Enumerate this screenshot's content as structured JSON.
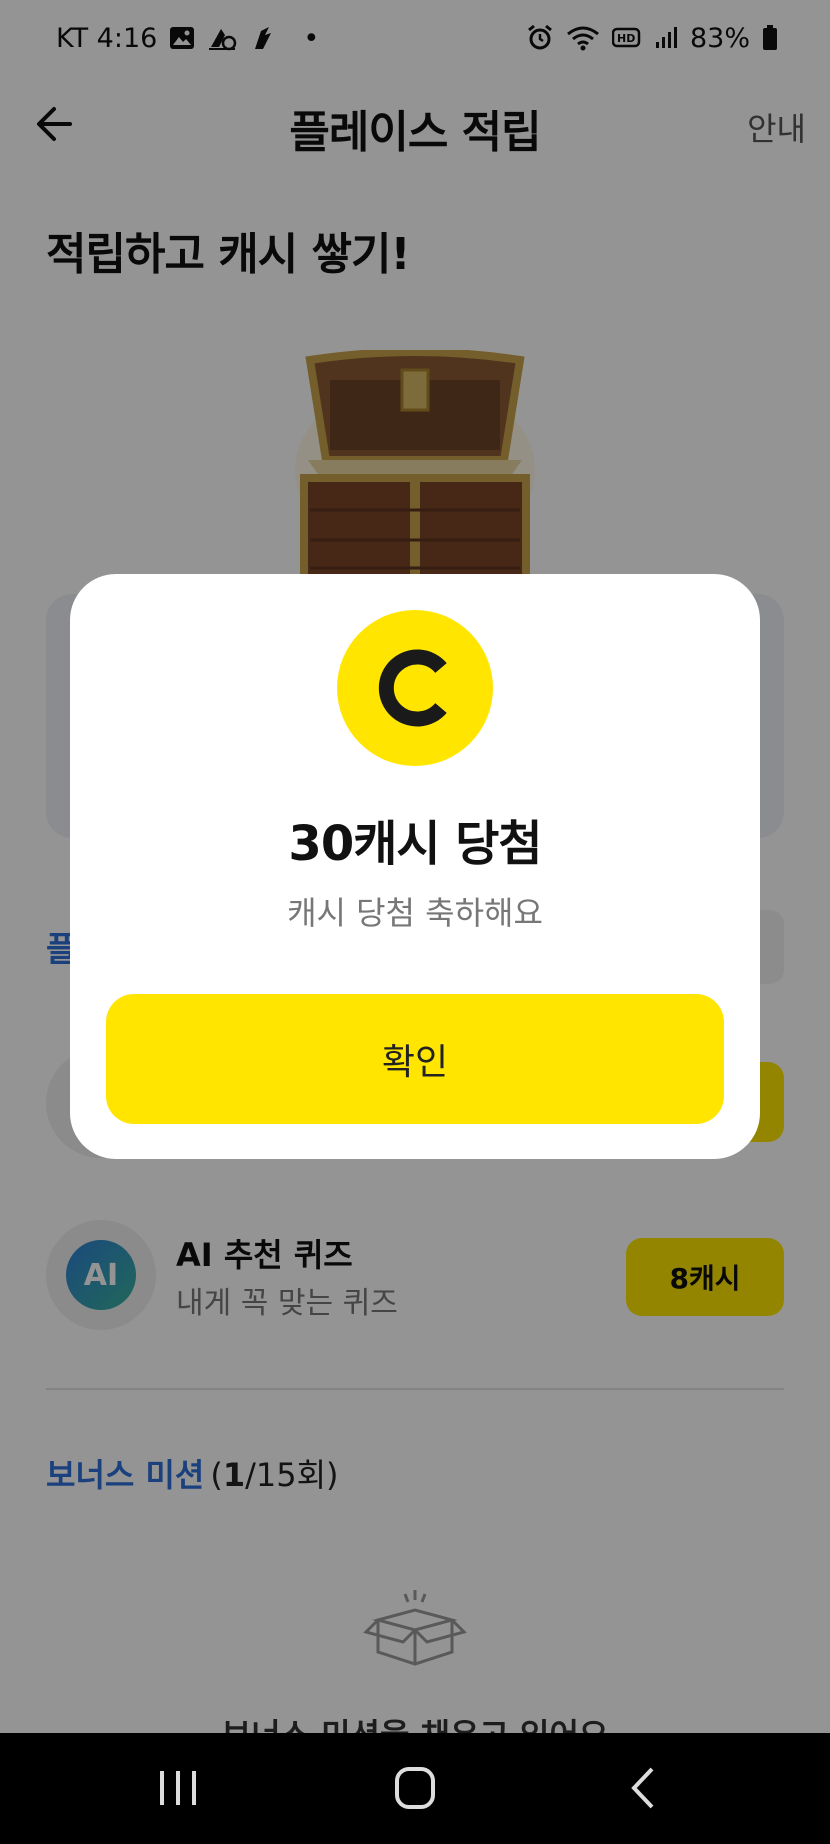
{
  "status_bar": {
    "carrier_time": "KT 4:16",
    "dot": "•",
    "battery": "83%",
    "icons": [
      "gallery-icon",
      "app-notification-icon",
      "app-notification-icon",
      "alarm-icon",
      "wifi-icon",
      "hd-icon",
      "signal-icon",
      "battery-icon"
    ]
  },
  "header": {
    "title": "플레이스 적립",
    "guide": "안내",
    "back_icon": "back-arrow-icon"
  },
  "page": {
    "headline": "적립하고 캐시 쌓기!",
    "section_peek": "플",
    "mission": {
      "icon_text": "AI",
      "title": "AI 추천 퀴즈",
      "subtitle": "내게 꼭 맞는 퀴즈",
      "reward": "8캐시"
    },
    "bonus": {
      "title": "보너스 미션",
      "count_open": "(",
      "count_done": "1",
      "count_rest": "/15회)"
    },
    "empty_text": "보너스 미션을 채우고 있어요"
  },
  "modal": {
    "coin_icon": "cash-coin-icon",
    "title": "30캐시 당첨",
    "subtitle": "캐시 당첨 축하해요",
    "confirm": "확인"
  },
  "colors": {
    "accent_yellow": "#ffe500",
    "accent_blue": "#2e6fd8",
    "overlay": "rgba(0,0,0,0.42)"
  }
}
